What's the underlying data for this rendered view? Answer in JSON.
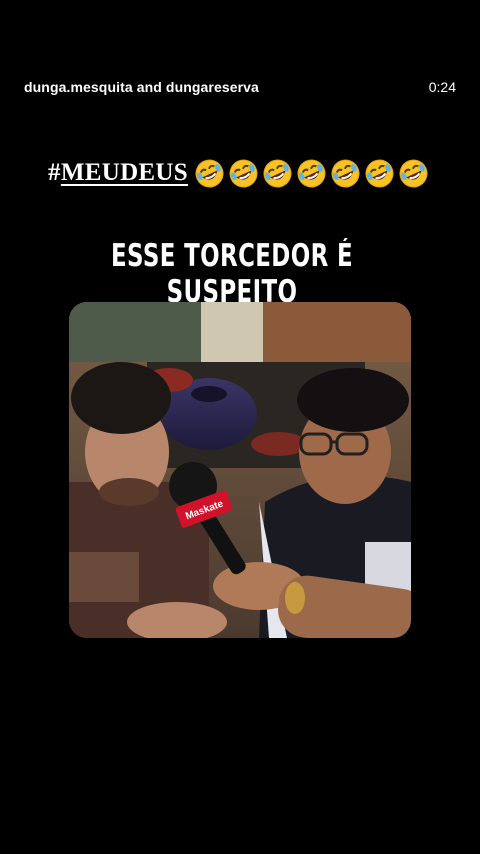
{
  "story": {
    "author": "dunga.mesquita and dungareserva",
    "timer": "0:24"
  },
  "caption": {
    "hashtag_symbol": "#",
    "hashtag_word": "MEUDEUS",
    "emoji": "rolling-on-floor-laughing-icon",
    "emoji_count": 7
  },
  "headline": "ESSE TORCEDOR É SUSPEITO",
  "video": {
    "microphone_label": "Maskate"
  }
}
